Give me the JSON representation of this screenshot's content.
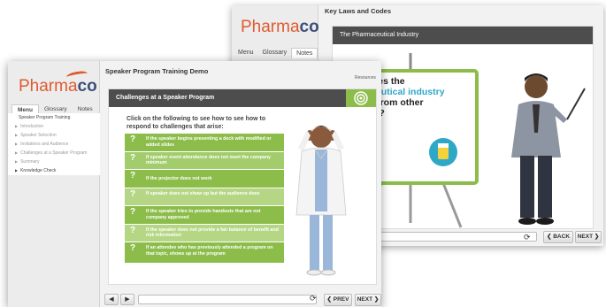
{
  "back_window": {
    "logo": {
      "text": "Pharma",
      "bold": "co"
    },
    "tabs": [
      "Menu",
      "Glossary",
      "Notes"
    ],
    "selected_tab": "Notes",
    "header_title": "Key Laws and Codes",
    "stage_title": "The Pharmaceutical Industry",
    "stage_text_1": "at makes the",
    "stage_text_2": "armaceutical industry",
    "stage_text_3": "ferent from other",
    "stage_text_4": "ustries?",
    "prev_label": "❮ BACK",
    "next_label": "NEXT ❯"
  },
  "front_window": {
    "logo": {
      "text": "Pharma",
      "bold": "co"
    },
    "tabs": [
      "Menu",
      "Glossary",
      "Notes"
    ],
    "selected_tab": "Menu",
    "header_title": "Speaker Program Training Demo",
    "resources_label": "Resources",
    "menu": {
      "root": "Speaker Program Training",
      "items": [
        "Introduction",
        "Speaker Selection",
        "Invitations and Audience",
        "Challenges at a Speaker Program",
        "Summary",
        "Knowledge Check"
      ]
    },
    "stage_title": "Challenges at a Speaker Program",
    "prompt": "Click on the following to see how to see how to respond to challenges that arise:",
    "options": [
      "If the speaker begins presenting a deck with modified or added slides",
      "If speaker event attendance does not meet the company minimum",
      "If the projector does not work",
      "If speaker does not show up but the audience does",
      "If the speaker tries to provide handouts that are not company approved",
      "If the speaker does not provide a fair balance of benefit and risk information",
      "If an attendee who has previously attended a program on that topic, shows up at the program"
    ],
    "option_marker": "?",
    "prev_label": "❮ PREV",
    "next_label": "NEXT ❯"
  },
  "colors": {
    "accent_green": "#8cbd4a",
    "header_dark": "#4d4d4d",
    "logo_orange": "#e05a30",
    "logo_blue": "#3d4f7a"
  },
  "icons": [
    "volume-icon",
    "play-icon",
    "reload-icon",
    "target-icon"
  ]
}
